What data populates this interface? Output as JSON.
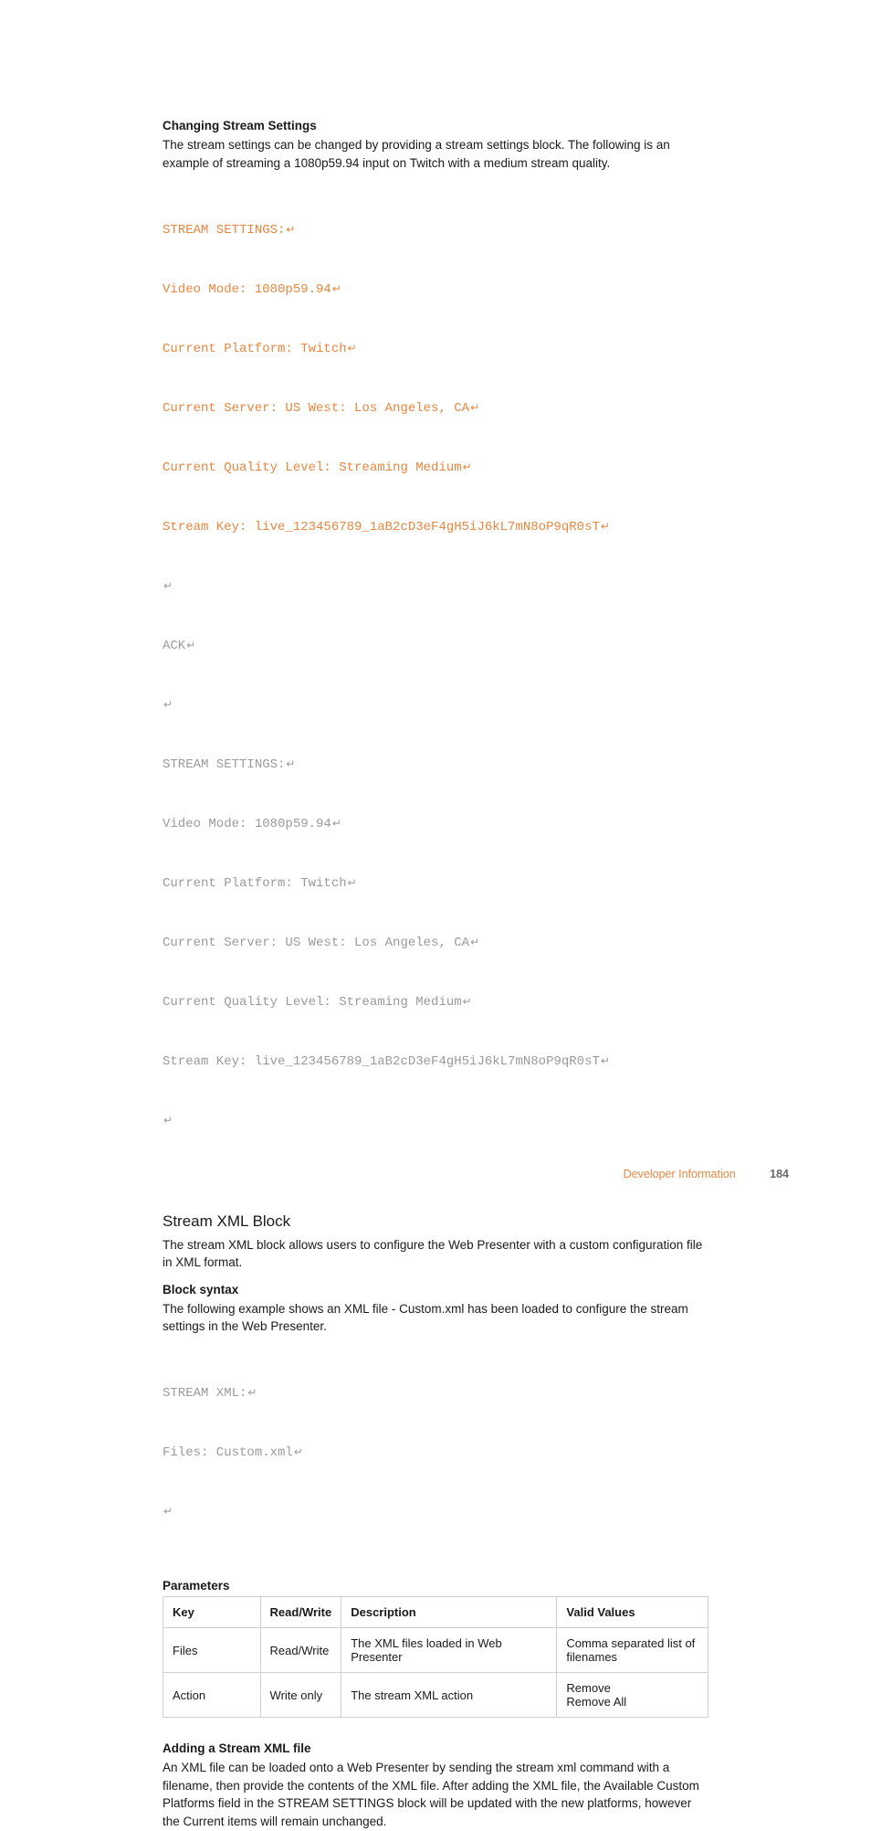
{
  "headings": {
    "changing_stream_settings": "Changing Stream Settings",
    "stream_xml_block": "Stream XML Block",
    "block_syntax": "Block syntax",
    "parameters": "Parameters",
    "adding_stream_xml_file": "Adding a Stream XML file"
  },
  "paragraphs": {
    "changing_intro": "The stream settings can be changed by providing a stream settings block. The following is an example of streaming a 1080p59.94 input on Twitch with a medium stream quality.",
    "stream_xml_intro": "The stream XML block allows users to configure the Web Presenter with a custom configuration file in XML format.",
    "block_syntax_text": "The following example shows an XML file - Custom.xml has been loaded to configure the stream settings in the Web Presenter.",
    "adding_text": "An XML file can be loaded onto a Web Presenter by sending the stream xml command with a filename, then provide the contents of the XML file. After adding the XML file, the Available Custom Platforms field in the STREAM SETTINGS block will be updated with the new platforms, however the Current items will remain unchanged."
  },
  "code1": {
    "l1": "STREAM SETTINGS:",
    "l2": "Video Mode: 1080p59.94",
    "l3": "Current Platform: Twitch",
    "l4": "Current Server: US West: Los Angeles, CA",
    "l5": "Current Quality Level: Streaming Medium",
    "l6": "Stream Key: live_123456789_1aB2cD3eF4gH5iJ6kL7mN8oP9qR0sT",
    "l7": "",
    "l8": "ACK",
    "l9": "",
    "l10": "STREAM SETTINGS:",
    "l11": "Video Mode: 1080p59.94",
    "l12": "Current Platform: Twitch",
    "l13": "Current Server: US West: Los Angeles, CA",
    "l14": "Current Quality Level: Streaming Medium",
    "l15": "Stream Key: live_123456789_1aB2cD3eF4gH5iJ6kL7mN8oP9qR0sT",
    "l16": ""
  },
  "code2": {
    "l1": "STREAM XML:",
    "l2": "Files: Custom.xml",
    "l3": ""
  },
  "table": {
    "headers": {
      "key": "Key",
      "rw": "Read/Write",
      "desc": "Description",
      "valid": "Valid Values"
    },
    "rows": [
      {
        "key": "Files",
        "rw": "Read/Write",
        "desc": "The XML files loaded in Web Presenter",
        "valid": "Comma separated list of filenames"
      },
      {
        "key": "Action",
        "rw": "Write only",
        "desc": "The stream XML action",
        "valid_l1": "Remove",
        "valid_l2": "Remove All"
      }
    ]
  },
  "footer": {
    "section": "Developer Information",
    "page": "184"
  },
  "glyphs": {
    "enter": "↵"
  }
}
